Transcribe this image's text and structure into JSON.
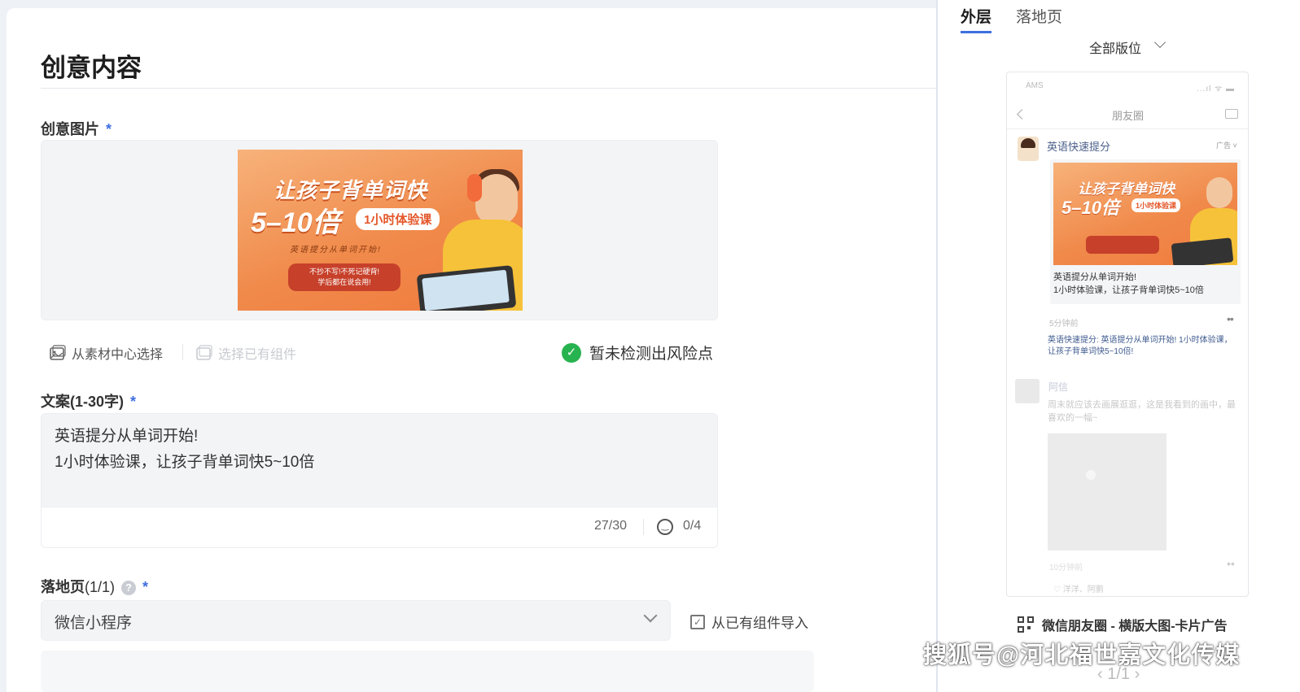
{
  "creative": {
    "title": "创意内容",
    "image_label": "创意图片",
    "required_mark": "*",
    "banner": {
      "line1": "让孩子背单词快",
      "line2": "5–10倍",
      "pill": "1小时体验课",
      "slogan": "英语提分从单词开始!",
      "red_box": "不抄不写!不死记硬背!\n学后都在说会用!"
    },
    "tool_from_library": "从素材中心选择",
    "tool_existing": "选择已有组件",
    "risk_status": "暂未检测出风险点",
    "copy_label": "文案",
    "copy_limit": "(1-30字)",
    "copy_line1": "英语提分从单词开始!",
    "copy_line2": "1小时体验课，让孩子背单词快5~10倍",
    "char_count": "27/30",
    "emoji_count": "0/4",
    "landing_label": "落地页",
    "landing_count": "(1/1)",
    "landing_select": "微信小程序",
    "import_from_component": "从已有组件导入"
  },
  "preview": {
    "tabs": [
      "外层",
      "落地页"
    ],
    "active_tab": 0,
    "position_select": "全部版位",
    "status_left": "AMS",
    "status_right": "...ıl ᯤ ▬",
    "nav_title": "朋友圈",
    "account_name": "英语快速提分",
    "ad_tag": "广告",
    "mini_banner": {
      "line1": "让孩子背单词快",
      "line2": "5–10倍",
      "pill": "1小时体验课"
    },
    "card_line1": "英语提分从单词开始!",
    "card_line2": "1小时体验课，让孩子背单词快5~10倍",
    "time": "5分钟前",
    "comment": "英语快速提分: 英语提分从单词开始! 1小时体验课，让孩子背单词快5~10倍!",
    "friend_name": "阿信",
    "friend_text": "周末就应该去画展逛逛，这是我看到的画中，最喜欢的一幅~",
    "time2": "10分钟前",
    "likes": "♡ 洋洋、阿鹏",
    "caption": "微信朋友圈 - 横版大图-卡片广告",
    "pager": "‹  1/1  ›"
  },
  "watermark": "搜狐号@河北福世嘉文化传媒",
  "colors": {
    "accent": "#3f6fe0",
    "success": "#27b34f",
    "banner_orange": "#f08a4b"
  }
}
